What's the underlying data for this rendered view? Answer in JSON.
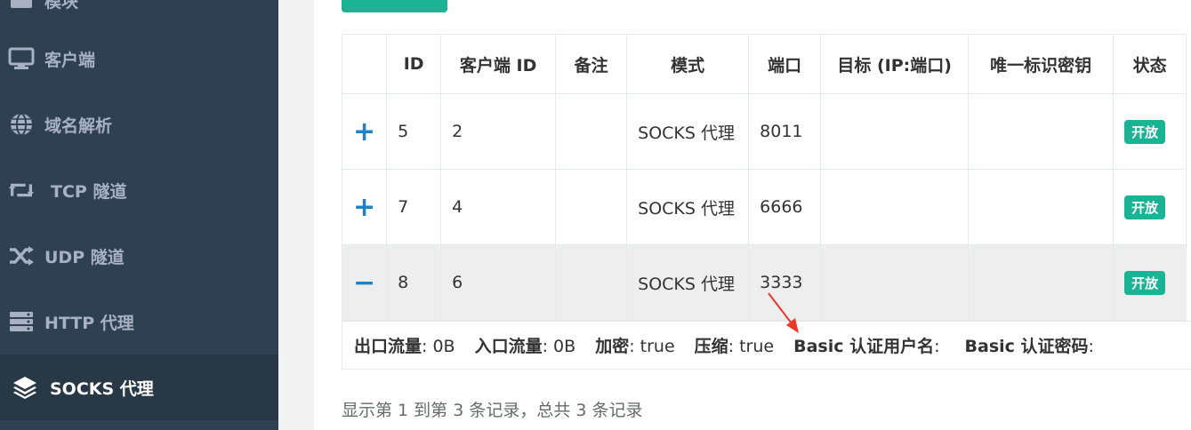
{
  "sidebar": {
    "items": [
      {
        "label": "模块",
        "icon": "list-icon"
      },
      {
        "label": "客户端",
        "icon": "monitor-icon"
      },
      {
        "label": "域名解析",
        "icon": "globe-icon"
      },
      {
        "label": "TCP 隧道",
        "icon": "retweet-icon"
      },
      {
        "label": "UDP 隧道",
        "icon": "shuffle-icon"
      },
      {
        "label": "HTTP 代理",
        "icon": "server-icon"
      },
      {
        "label": "SOCKS 代理",
        "icon": "layers-icon"
      }
    ]
  },
  "table": {
    "headers": [
      "",
      "ID",
      "客户端 ID",
      "备注",
      "模式",
      "端口",
      "目标 (IP:端口)",
      "唯一标识密钥",
      "状态"
    ],
    "rows": [
      {
        "toggle": "+",
        "id": "5",
        "client_id": "2",
        "remark": "",
        "mode": "SOCKS 代理",
        "port": "8011",
        "target": "",
        "key": "",
        "status": "开放"
      },
      {
        "toggle": "+",
        "id": "7",
        "client_id": "4",
        "remark": "",
        "mode": "SOCKS 代理",
        "port": "6666",
        "target": "",
        "key": "",
        "status": "开放"
      },
      {
        "toggle": "−",
        "id": "8",
        "client_id": "6",
        "remark": "",
        "mode": "SOCKS 代理",
        "port": "3333",
        "target": "",
        "key": "",
        "status": "开放"
      }
    ]
  },
  "detail": {
    "out_flow_label": "出口流量",
    "out_flow_value": ": 0B",
    "in_flow_label": "入口流量",
    "in_flow_value": ": 0B",
    "crypt_label": "加密",
    "crypt_value": ": true",
    "compress_label": "压缩",
    "compress_value": ": true",
    "basic_user_label": "Basic 认证用户名",
    "basic_user_value": ":",
    "basic_pass_label": "Basic 认证密码",
    "basic_pass_value": ":"
  },
  "pagination": {
    "info": "显示第 1 到第 3 条记录，总共 3 条记录"
  },
  "colors": {
    "sidebar_bg": "#2f4050",
    "accent": "#1ab394",
    "toggle": "#1c84c6",
    "annotation": "#e8392f"
  }
}
